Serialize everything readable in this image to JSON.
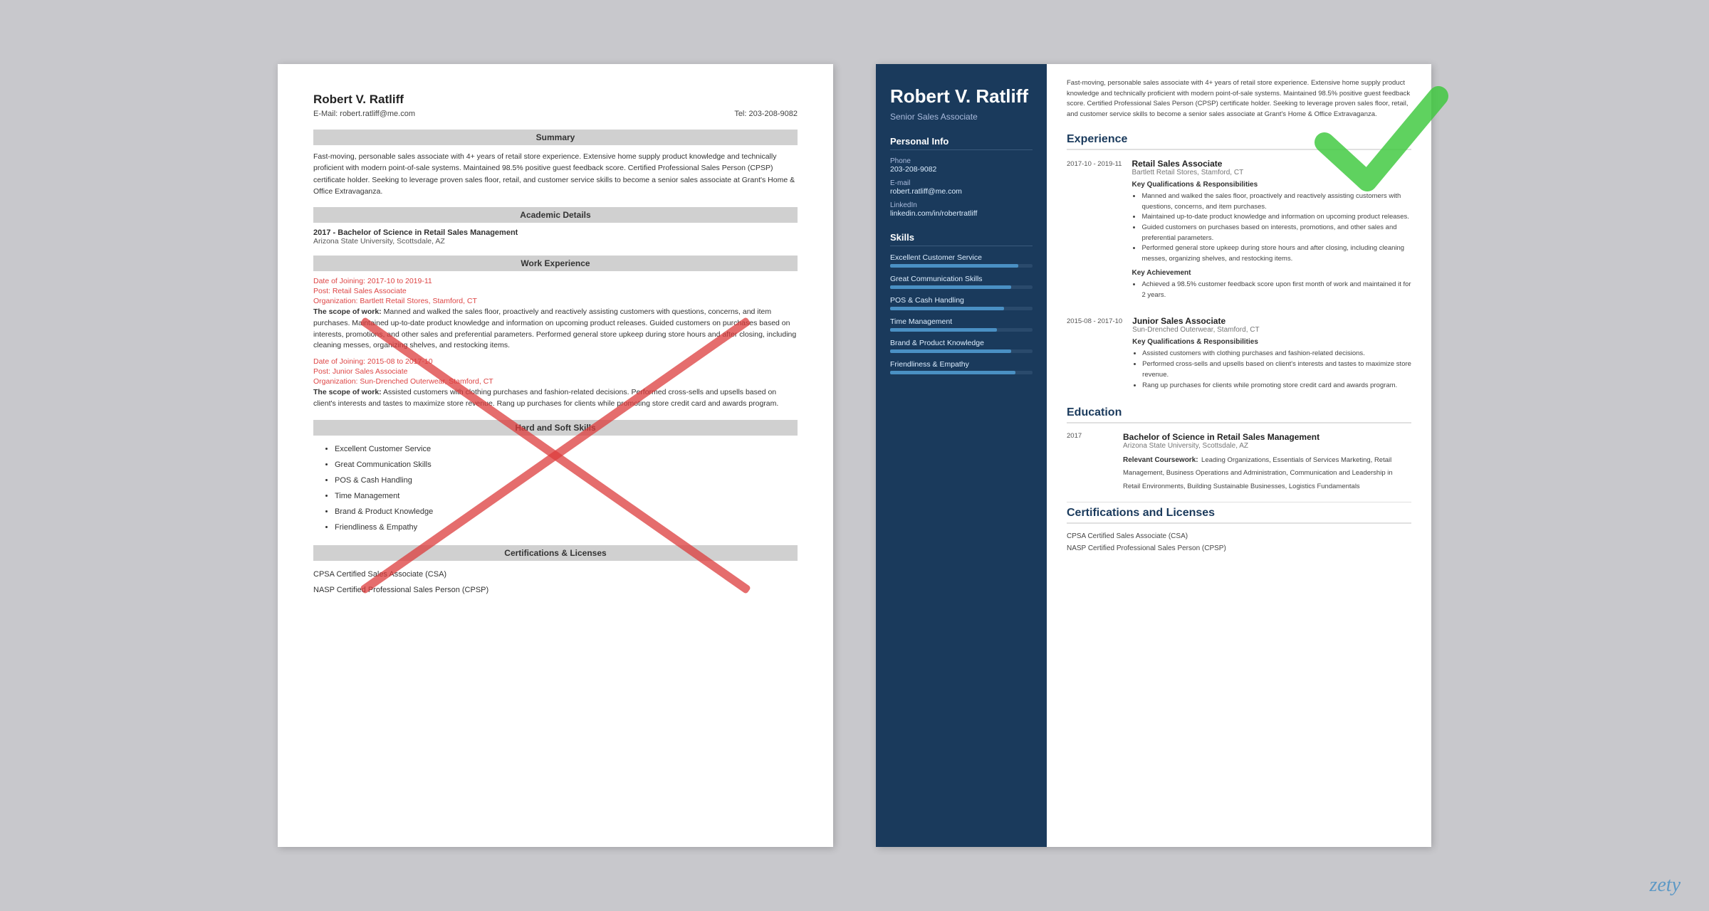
{
  "page": {
    "background": "#c8c8cc"
  },
  "left_resume": {
    "name": "Robert V. Ratliff",
    "email_label": "E-Mail: robert.ratliff@me.com",
    "tel_label": "Tel: 203-208-9082",
    "sections": {
      "summary_heading": "Summary",
      "summary_text": "Fast-moving, personable sales associate with 4+ years of retail store experience. Extensive home supply product knowledge and technically proficient with modern point-of-sale systems. Maintained 98.5% positive guest feedback score. Certified Professional Sales Person (CPSP) certificate holder. Seeking to leverage proven sales floor, retail, and customer service skills to become a senior sales associate at Grant's Home & Office Extravaganza.",
      "academic_heading": "Academic Details",
      "edu_year": "2017 - Bachelor of Science in Retail Sales Management",
      "edu_school": "Arizona State University, Scottsdale, AZ",
      "work_heading": "Work Experience",
      "job1_date": "Date of Joining: 2017-10 to 2019-11",
      "job1_post": "Post: Retail Sales Associate",
      "job1_org": "Organization: Bartlett Retail Stores, Stamford, CT",
      "job1_scope_label": "The scope of work:",
      "job1_scope": "Manned and walked the sales floor, proactively and reactively assisting customers with questions, concerns, and item purchases. Maintained up-to-date product knowledge and information on upcoming product releases. Guided customers on purchases based on interests, promotions, and other sales and preferential parameters. Performed general store upkeep during store hours and after closing, including cleaning messes, organizing shelves, and restocking items.",
      "job2_date": "Date of Joining: 2015-08 to 2017-10",
      "job2_post": "Post: Junior Sales Associate",
      "job2_org": "Organization: Sun-Drenched Outerwear, Stamford, CT",
      "job2_scope_label": "The scope of work:",
      "job2_scope": "Assisted customers with clothing purchases and fashion-related decisions. Performed cross-sells and upsells based on client's interests and tastes to maximize store revenue. Rang up purchases for clients while promoting store credit card and awards program.",
      "skills_heading": "Hard and Soft Skills",
      "skills": [
        "Excellent Customer Service",
        "Great Communication Skills",
        "POS & Cash Handling",
        "Time Management",
        "Brand & Product Knowledge",
        "Friendliness & Empathy"
      ],
      "certs_heading": "Certifications & Licenses",
      "cert1": "CPSA Certified Sales Associate (CSA)",
      "cert2": "NASP Certified Professional Sales Person (CPSP)"
    }
  },
  "right_resume": {
    "name": "Robert V. Ratliff",
    "title": "Senior Sales Associate",
    "sidebar": {
      "personal_info_heading": "Personal Info",
      "phone_label": "Phone",
      "phone_value": "203-208-9082",
      "email_label": "E-mail",
      "email_value": "robert.ratliff@me.com",
      "linkedin_label": "LinkedIn",
      "linkedin_value": "linkedin.com/in/robertratliff",
      "skills_heading": "Skills",
      "skills": [
        {
          "name": "Excellent Customer Service",
          "pct": 90
        },
        {
          "name": "Great Communication Skills",
          "pct": 85
        },
        {
          "name": "POS & Cash Handling",
          "pct": 80
        },
        {
          "name": "Time Management",
          "pct": 75
        },
        {
          "name": "Brand & Product Knowledge",
          "pct": 85
        },
        {
          "name": "Friendliness & Empathy",
          "pct": 88
        }
      ]
    },
    "summary_text": "Fast-moving, personable sales associate with 4+ years of retail store experience. Extensive home supply product knowledge and technically proficient with modern point-of-sale systems. Maintained 98.5% positive guest feedback score. Certified Professional Sales Person (CPSP) certificate holder. Seeking to leverage proven sales floor, retail, and customer service skills to become a senior sales associate at Grant's Home & Office Extravaganza.",
    "experience_heading": "Experience",
    "jobs": [
      {
        "dates": "2017-10 - 2019-11",
        "title": "Retail Sales Associate",
        "company": "Bartlett Retail Stores, Stamford, CT",
        "kq_heading": "Key Qualifications & Responsibilities",
        "bullets": [
          "Manned and walked the sales floor, proactively and reactively assisting customers with questions, concerns, and item purchases.",
          "Maintained up-to-date product knowledge and information on upcoming product releases.",
          "Guided customers on purchases based on interests, promotions, and other sales and preferential parameters.",
          "Performed general store upkeep during store hours and after closing, including cleaning messes, organizing shelves, and restocking items."
        ],
        "achievement_heading": "Key Achievement",
        "achievement": "Achieved a 98.5% customer feedback score upon first month of work and maintained it for 2 years."
      },
      {
        "dates": "2015-08 - 2017-10",
        "title": "Junior Sales Associate",
        "company": "Sun-Drenched Outerwear, Stamford, CT",
        "kq_heading": "Key Qualifications & Responsibilities",
        "bullets": [
          "Assisted customers with clothing purchases and fashion-related decisions.",
          "Performed cross-sells and upsells based on client's interests and tastes to maximize store revenue.",
          "Rang up purchases for clients while promoting store credit card and awards program."
        ]
      }
    ],
    "education_heading": "Education",
    "edu_year": "2017",
    "edu_degree": "Bachelor of Science in Retail Sales Management",
    "edu_school": "Arizona State University, Scottsdale, AZ",
    "edu_coursework_label": "Relevant Coursework:",
    "edu_coursework": "Leading Organizations, Essentials of Services Marketing, Retail Management, Business Operations and Administration, Communication and Leadership in Retail Environments, Building Sustainable Businesses, Logistics Fundamentals",
    "certs_heading": "Certifications and Licenses",
    "cert1": "CPSA Certified Sales Associate (CSA)",
    "cert2": "NASP Certified Professional Sales Person (CPSP)"
  },
  "watermark": "zety"
}
